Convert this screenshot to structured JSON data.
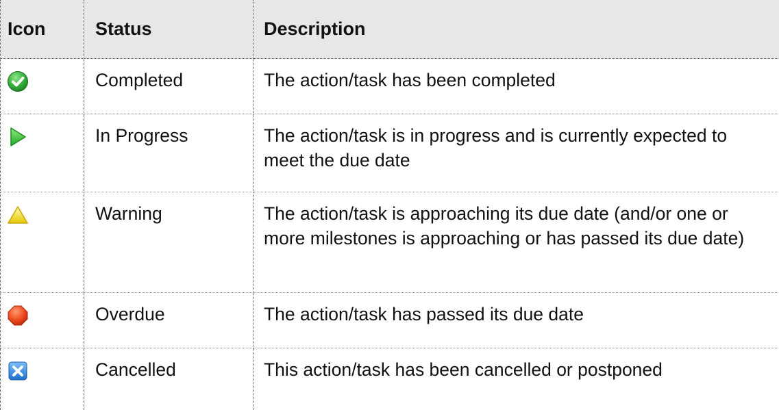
{
  "table": {
    "headers": {
      "icon": "Icon",
      "status": "Status",
      "description": "Description"
    },
    "rows": [
      {
        "icon": "green-check-icon",
        "status": "Completed",
        "description": "The action/task has been completed"
      },
      {
        "icon": "green-play-icon",
        "status": "In Progress",
        "description": "The action/task is in progress and is currently expected to meet the due date"
      },
      {
        "icon": "yellow-warning-icon",
        "status": "Warning",
        "description": "The action/task is approaching its due date (and/or one or more milestones is approaching or has passed its due date)"
      },
      {
        "icon": "red-octagon-icon",
        "status": "Overdue",
        "description": "The action/task has passed its due date"
      },
      {
        "icon": "blue-cancel-icon",
        "status": "Cancelled",
        "description": "This action/task has been cancelled or postponed"
      }
    ]
  },
  "colors": {
    "header_bg": "#e7e7e7",
    "completed": "#2fae3a",
    "in_progress": "#3cc23c",
    "warning": "#f2e200",
    "overdue": "#e8431a",
    "cancelled": "#2a7fd4"
  }
}
